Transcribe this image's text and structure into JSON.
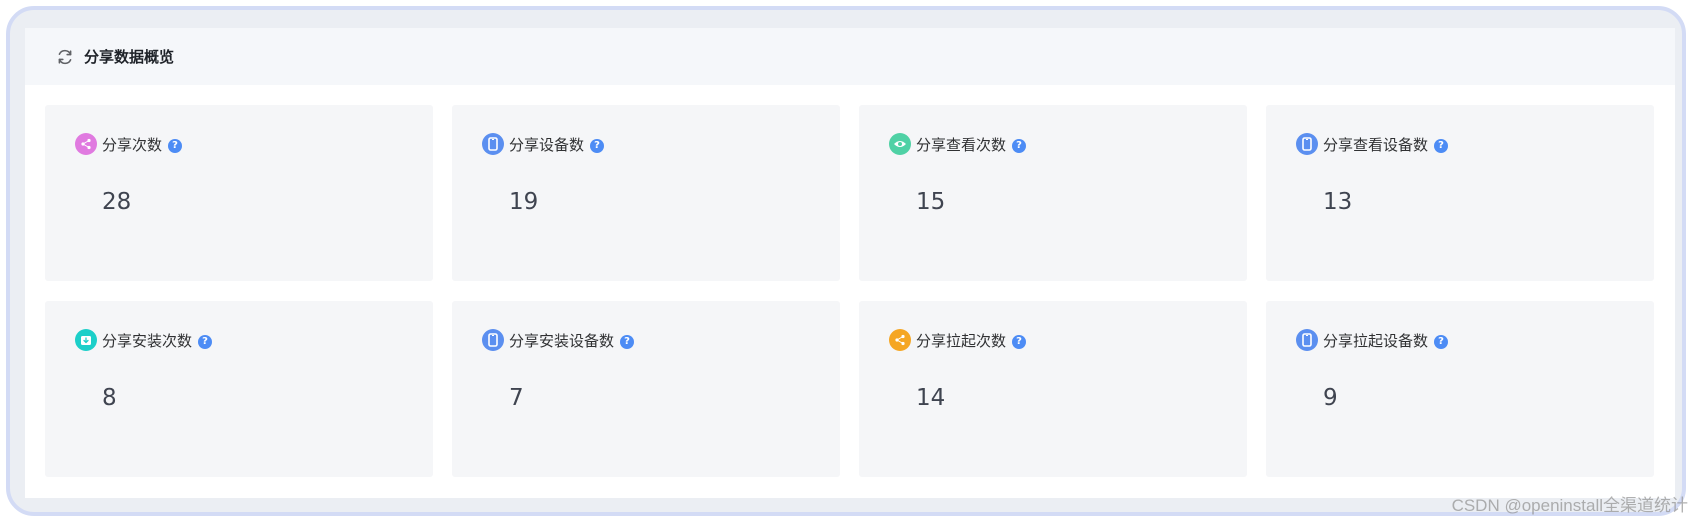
{
  "panel": {
    "title": "分享数据概览"
  },
  "metrics": [
    {
      "label": "分享次数",
      "value": "28",
      "icon": "share-icon",
      "color": "#e07ae0"
    },
    {
      "label": "分享设备数",
      "value": "19",
      "icon": "phone-icon",
      "color": "#5b8ff0"
    },
    {
      "label": "分享查看次数",
      "value": "15",
      "icon": "eye-icon",
      "color": "#4fd1a5"
    },
    {
      "label": "分享查看设备数",
      "value": "13",
      "icon": "phone-icon",
      "color": "#5b8ff0"
    },
    {
      "label": "分享安装次数",
      "value": "8",
      "icon": "install-icon",
      "color": "#1ccfc9"
    },
    {
      "label": "分享安装设备数",
      "value": "7",
      "icon": "phone-icon",
      "color": "#5b8ff0"
    },
    {
      "label": "分享拉起次数",
      "value": "14",
      "icon": "share-icon",
      "color": "#f5a623"
    },
    {
      "label": "分享拉起设备数",
      "value": "9",
      "icon": "phone-icon",
      "color": "#5b8ff0"
    }
  ],
  "help_symbol": "?",
  "watermark": "CSDN @openinstall全渠道统计"
}
